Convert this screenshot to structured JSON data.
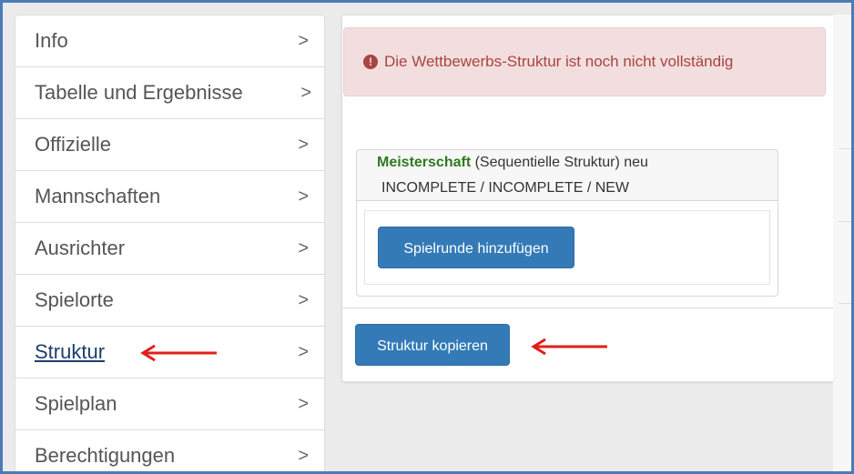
{
  "sidebar": {
    "items": [
      {
        "label": "Info",
        "chevron": ">"
      },
      {
        "label": "Tabelle und Ergebnisse",
        "chevron": ">"
      },
      {
        "label": "Offizielle",
        "chevron": ">"
      },
      {
        "label": "Mannschaften",
        "chevron": ">"
      },
      {
        "label": "Ausrichter",
        "chevron": ">"
      },
      {
        "label": "Spielorte",
        "chevron": ">"
      },
      {
        "label": "Struktur",
        "chevron": ">"
      },
      {
        "label": "Spielplan",
        "chevron": ">"
      },
      {
        "label": "Berechtigungen",
        "chevron": ">"
      }
    ],
    "active_index": 6
  },
  "alert": {
    "icon": "exclamation-circle-icon",
    "icon_glyph": "!",
    "text": "Die Wettbewerbs-Struktur ist noch nicht vollständig"
  },
  "structure_tab": {
    "name": "Meisterschaft",
    "type_text": " (Sequentielle Struktur) neu",
    "status_text": "INCOMPLETE / INCOMPLETE / NEW"
  },
  "buttons": {
    "add_round_label": "Spielrunde hinzufügen",
    "copy_structure_label": "Struktur kopieren"
  },
  "colors": {
    "frame_border": "#4a7bb7",
    "primary_button": "#337ab7",
    "alert_background": "#f2dede",
    "alert_text": "#a94442",
    "tab_name": "#2f7a1e",
    "annotation_arrow": "#e0201b"
  }
}
